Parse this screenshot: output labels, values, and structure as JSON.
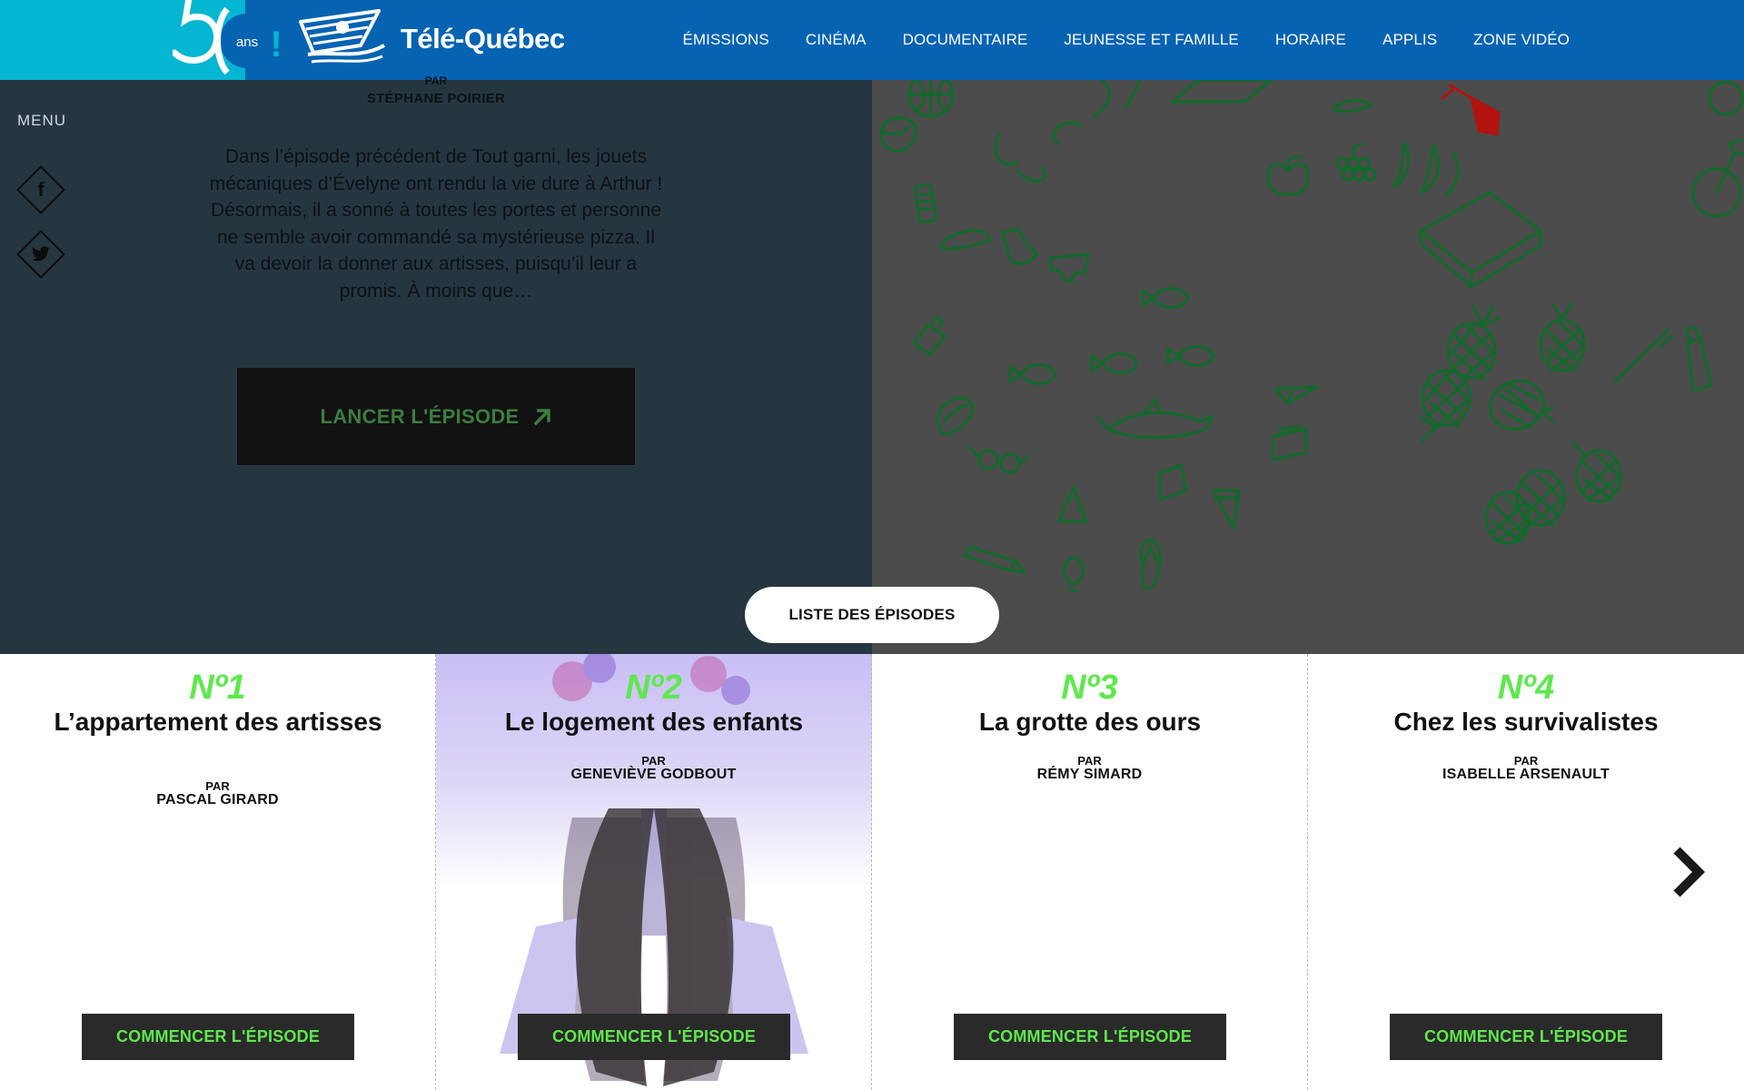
{
  "header": {
    "anniversary_number": "50",
    "anniversary_unit": "ans",
    "anniversary_mark": "!",
    "brand": "Télé-Québec",
    "nav": [
      "ÉMISSIONS",
      "CINÉMA",
      "DOCUMENTAIRE",
      "JEUNESSE ET FAMILLE",
      "HORAIRE",
      "APPLIS",
      "ZONE VIDÉO"
    ]
  },
  "sidebar": {
    "menu_label": "MENU",
    "facebook_icon": "f",
    "twitter_icon": "twitter-bird"
  },
  "hero": {
    "par_label": "PAR",
    "author": "STÉPHANE POIRIER",
    "description": "Dans l’épisode précédent de Tout garni, les jouets mécaniques d’Évelyne ont rendu la vie dure à Arthur ! Désormais, il a sonné à toutes les portes et personne ne semble avoir commandé sa mystérieuse pizza. Il va devoir la donner aux artisses, puisqu’il leur a promis. À moins que…",
    "launch_label": "LANCER L'ÉPISODE",
    "colors": {
      "panel": "#263641",
      "illustration_bg": "#4b4b4b",
      "icon_stroke": "#0f6b2a",
      "accent_red": "#b3120f"
    }
  },
  "episodes_list_label": "LISTE DES ÉPISODES",
  "episodes": [
    {
      "number": "Nº1",
      "title": "L’appartement des artisses",
      "par": "PAR",
      "author": "PASCAL GIRARD",
      "button": "COMMENCER L'ÉPISODE"
    },
    {
      "number": "Nº2",
      "title": "Le logement des enfants",
      "par": "PAR",
      "author": "GENEVIÈVE GODBOUT",
      "button": "COMMENCER L'ÉPISODE"
    },
    {
      "number": "Nº3",
      "title": "La grotte des ours",
      "par": "PAR",
      "author": "RÉMY SIMARD",
      "button": "COMMENCER L'ÉPISODE"
    },
    {
      "number": "Nº4",
      "title": "Chez les survivalistes",
      "par": "PAR",
      "author": "ISABELLE ARSENAULT",
      "button": "COMMENCER L'ÉPISODE"
    }
  ],
  "colors": {
    "header_blue": "#0563b2",
    "header_teal": "#05b6d3",
    "accent_green": "#5ee84d"
  },
  "icons": {
    "next": "chevron-right-icon",
    "launch": "arrow-up-right-icon"
  }
}
